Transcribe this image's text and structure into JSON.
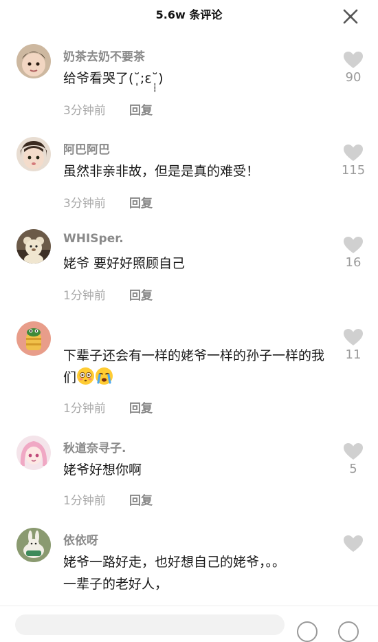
{
  "header": {
    "title": "5.6w 条评论",
    "close_icon": "close-icon"
  },
  "reply_label": "回复",
  "comments": [
    {
      "username": "奶茶去奶不要茶",
      "text": "给爷看哭了(˘̩̩̩;ε˘̩̩̩)",
      "time": "3分钟前",
      "likes": "90",
      "avatar": "baby-avatar"
    },
    {
      "username": "阿巴阿巴",
      "text": "虽然非亲非故，但是是真的难受！",
      "time": "3分钟前",
      "likes": "115",
      "avatar": "child-avatar"
    },
    {
      "username": "WHISper.",
      "text": "姥爷 要好好照顾自己",
      "time": "1分钟前",
      "likes": "16",
      "avatar": "teddy-bear-avatar"
    },
    {
      "username": "",
      "text": "下辈子还会有一样的姥爷一样的孙子一样的我们",
      "time": "1分钟前",
      "likes": "11",
      "avatar": "cartoon-avatar",
      "emojis": [
        "flushed-face-emoji",
        "crying-face-emoji"
      ]
    },
    {
      "username": "秋道奈寻子.",
      "text": "姥爷好想你啊",
      "time": "1分钟前",
      "likes": "5",
      "avatar": "anime-girl-avatar"
    },
    {
      "username": "依依呀",
      "text": "姥爷一路好走，也好想自己的姥爷，。。一辈子的老好人，",
      "time": "",
      "likes": "",
      "avatar": "rabbit-avatar"
    }
  ],
  "colors": {
    "username": "#8a8a8a",
    "meta": "#a8a8a8",
    "heart": "#d0d0d0"
  }
}
